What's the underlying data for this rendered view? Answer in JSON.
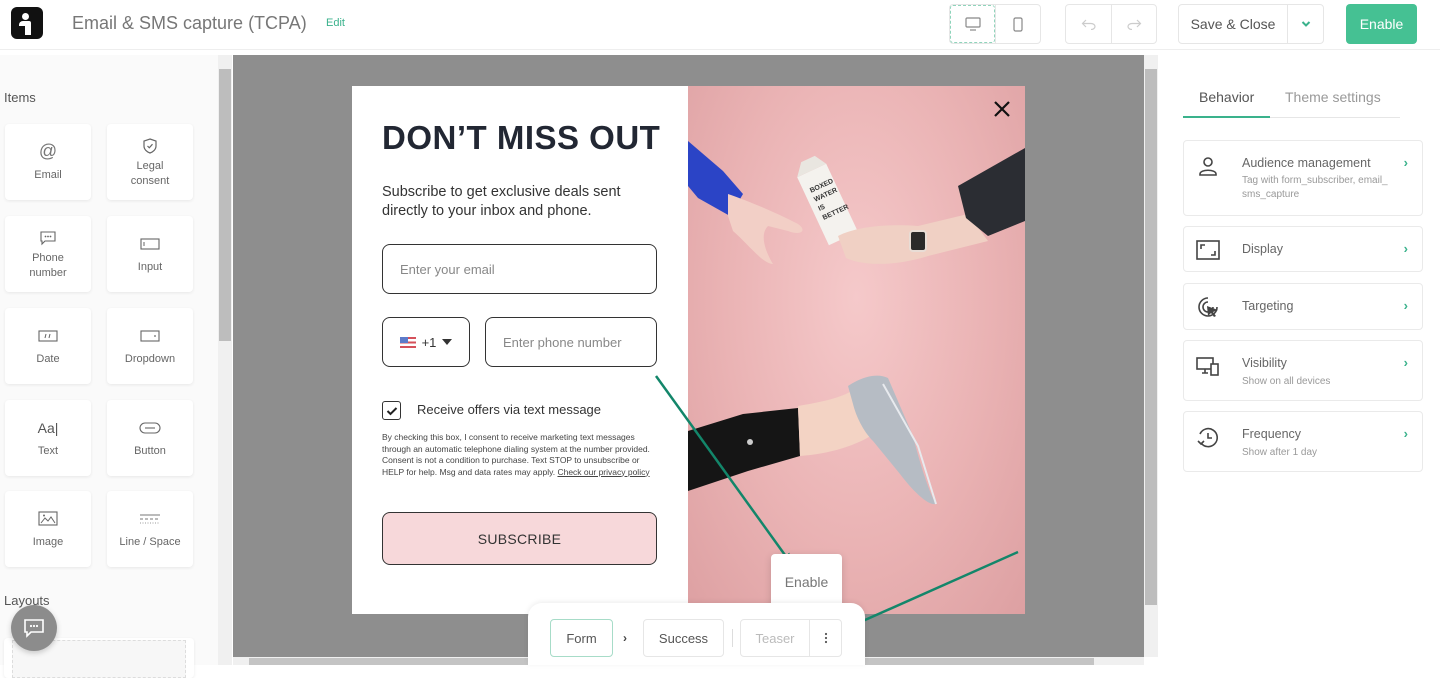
{
  "header": {
    "title": "Email & SMS capture (TCPA)",
    "edit_label": "Edit",
    "view_toggle": [
      {
        "name": "desktop",
        "icon": "desktop-icon",
        "active": true
      },
      {
        "name": "mobile",
        "icon": "mobile-icon",
        "active": false
      }
    ],
    "undo_icon": "undo-icon",
    "redo_icon": "redo-icon",
    "save_label": "Save & Close",
    "save_dropdown_icon": "chevron-down-icon",
    "enable_label": "Enable",
    "colors": {
      "accent": "#45c193",
      "accent_text": "#3ab28c"
    }
  },
  "left_panel": {
    "items_label": "Items",
    "items": [
      {
        "label": "Email",
        "icon": "at-icon"
      },
      {
        "label": "Legal consent",
        "icon": "shield-check-icon"
      },
      {
        "label": "Phone number",
        "icon": "chat-bubble-icon"
      },
      {
        "label": "Input",
        "icon": "input-icon"
      },
      {
        "label": "Date",
        "icon": "date-icon"
      },
      {
        "label": "Dropdown",
        "icon": "dropdown-icon"
      },
      {
        "label": "Text",
        "icon": "text-icon",
        "glyph": "Aa|"
      },
      {
        "label": "Button",
        "icon": "button-icon"
      },
      {
        "label": "Image",
        "icon": "image-icon"
      },
      {
        "label": "Line / Space",
        "icon": "line-space-icon"
      }
    ],
    "layouts_label": "Layouts",
    "chat_icon": "chat-icon"
  },
  "popup": {
    "headline": "DON’T MISS OUT",
    "subtitle": "Subscribe to get exclusive deals sent directly to your inbox and phone.",
    "email_placeholder": "Enter your email",
    "country_code": "+1",
    "country_flag": "us-flag-icon",
    "phone_placeholder": "Enter phone number",
    "checkbox_checked": true,
    "checkbox_label": "Receive offers via text message",
    "legal_text": "By checking this box, I consent to receive marketing text messages through an automatic telephone dialing system at the number provided. Consent is not a condition to purchase. Text STOP to unsubscribe or HELP for help. Msg and data rates may apply.",
    "privacy_link": "Check our privacy policy",
    "subscribe_label": "SUBSCRIBE",
    "image_alt": "Two hands passing a carton of water on pink background, with a leg in sneaker",
    "carton_text": "BOXED WATER IS BETTER",
    "colors": {
      "button_bg": "#f7d8da",
      "image_bg": "#eab3b4",
      "headline": "#222733"
    }
  },
  "enable_tooltip": {
    "label": "Enable"
  },
  "steps": {
    "items": [
      {
        "label": "Form",
        "active": true
      },
      {
        "label": "Success",
        "active": false
      },
      {
        "label": "Teaser",
        "active": false,
        "disabled": true
      }
    ],
    "more_icon": "more-vertical-icon"
  },
  "right_panel": {
    "tabs": [
      {
        "label": "Behavior",
        "active": true
      },
      {
        "label": "Theme settings",
        "active": false
      }
    ],
    "cards": [
      {
        "title": "Audience management",
        "subtitle": "Tag with form_subscriber, email_ sms_capture",
        "icon": "user-icon"
      },
      {
        "title": "Display",
        "subtitle": "",
        "icon": "display-frame-icon"
      },
      {
        "title": "Targeting",
        "subtitle": "",
        "icon": "targeting-icon"
      },
      {
        "title": "Visibility",
        "subtitle": "Show on all devices",
        "icon": "devices-icon"
      },
      {
        "title": "Frequency",
        "subtitle": "Show after 1 day",
        "icon": "history-icon"
      }
    ]
  },
  "annotations": {
    "arrow_color": "#13866a"
  }
}
